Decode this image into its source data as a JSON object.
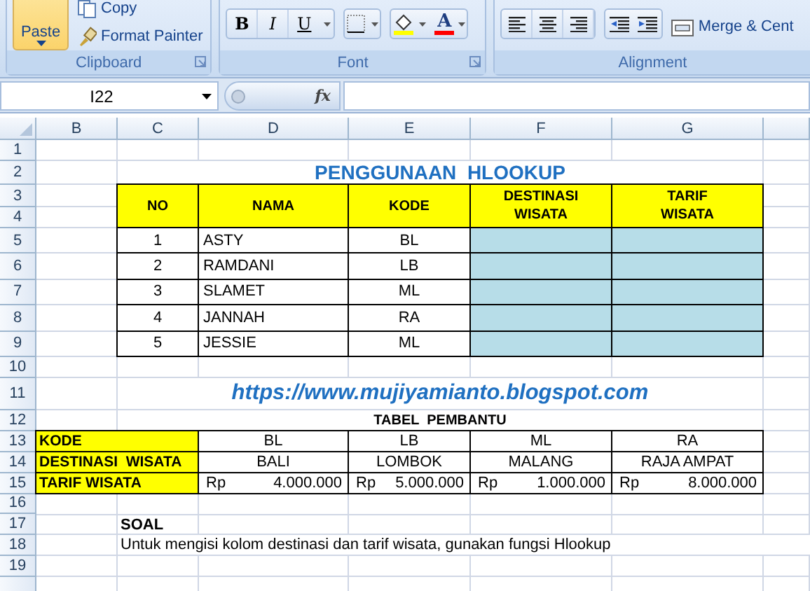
{
  "ribbon": {
    "clipboard": {
      "paste": "Paste",
      "copy": "Copy",
      "format_painter": "Format Painter",
      "label": "Clipboard"
    },
    "font": {
      "bold": "B",
      "italic": "I",
      "underline": "U",
      "font_color": "A",
      "label": "Font"
    },
    "alignment": {
      "merge": "Merge & Cent",
      "label": "Alignment"
    }
  },
  "formula_bar": {
    "name_box": "I22",
    "fx": "fx"
  },
  "sheet": {
    "columns": [
      "B",
      "C",
      "D",
      "E",
      "F",
      "G"
    ],
    "rows": [
      "1",
      "2",
      "3",
      "4",
      "5",
      "6",
      "7",
      "8",
      "9",
      "10",
      "11",
      "12",
      "13",
      "14",
      "15",
      "16",
      "17",
      "18",
      "19"
    ],
    "title": "PENGGUNAAN  HLOOKUP",
    "main_table": {
      "columns": [
        "NO",
        "NAMA",
        "KODE",
        "DESTINASI\nWISATA",
        "TARIF\nWISATA"
      ],
      "rows": [
        {
          "no": "1",
          "nama": "ASTY",
          "kode": "BL"
        },
        {
          "no": "2",
          "nama": "RAMDANI",
          "kode": "LB"
        },
        {
          "no": "3",
          "nama": "SLAMET",
          "kode": "ML"
        },
        {
          "no": "4",
          "nama": "JANNAH",
          "kode": "RA"
        },
        {
          "no": "5",
          "nama": "JESSIE",
          "kode": "ML"
        }
      ]
    },
    "url": "https://www.mujiyamianto.blogspot.com",
    "helper_title": "TABEL  PEMBANTU",
    "helper_table": [
      {
        "kind": "text",
        "label": "KODE",
        "values": [
          "BL",
          "LB",
          "ML",
          "RA"
        ]
      },
      {
        "kind": "text",
        "label": "DESTINASI  WISATA",
        "values": [
          "BALI",
          "LOMBOK",
          "MALANG",
          "RAJA AMPAT"
        ]
      },
      {
        "kind": "money",
        "label": "TARIF WISATA",
        "values": [
          {
            "currency": "Rp",
            "amount": "4.000.000"
          },
          {
            "currency": "Rp",
            "amount": "5.000.000"
          },
          {
            "currency": "Rp",
            "amount": "1.000.000"
          },
          {
            "currency": "Rp",
            "amount": "8.000.000"
          }
        ]
      }
    ],
    "soal": {
      "heading": "SOAL",
      "text": "Untuk mengisi kolom destinasi dan tarif wisata, gunakan fungsi Hlookup"
    }
  }
}
